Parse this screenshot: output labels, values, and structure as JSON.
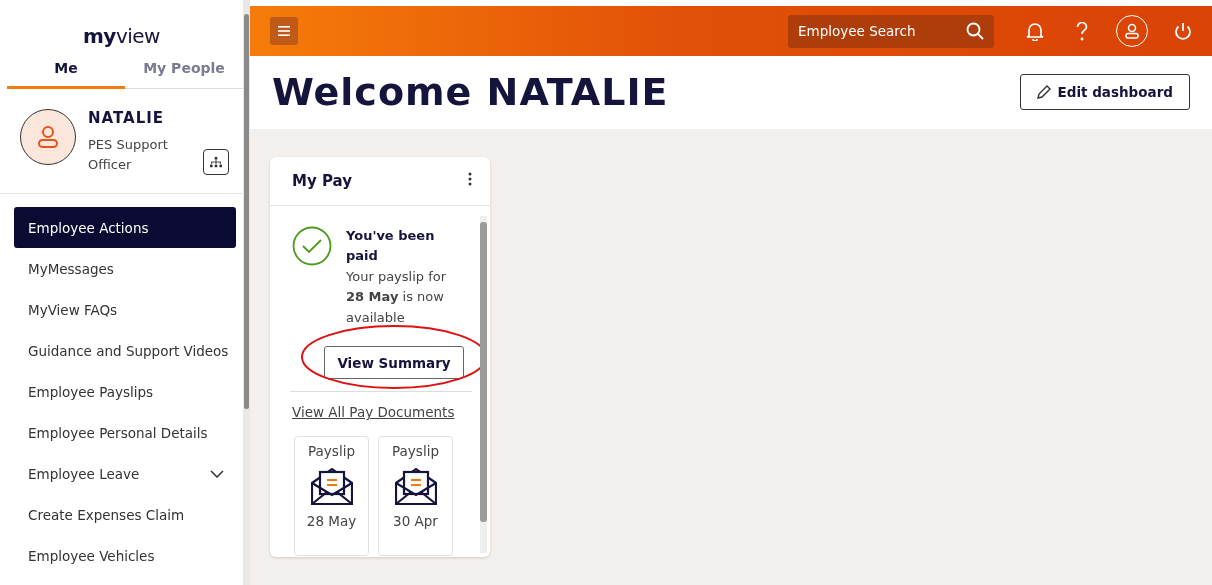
{
  "sidebar": {
    "logo": "**my**view",
    "tabs": [
      {
        "label": "Me",
        "selected": true
      },
      {
        "label": "My People",
        "selected": false
      }
    ],
    "profile": {
      "name": "NATALIE",
      "role": "PES Support Officer"
    },
    "items": [
      {
        "label": "Employee Actions",
        "selected": true,
        "expandable": false
      },
      {
        "label": "MyMessages",
        "selected": false,
        "expandable": false
      },
      {
        "label": "MyView FAQs",
        "selected": false,
        "expandable": false
      },
      {
        "label": "Guidance and Support Videos",
        "selected": false,
        "expandable": false
      },
      {
        "label": "Employee Payslips",
        "selected": false,
        "expandable": false
      },
      {
        "label": "Employee Personal Details",
        "selected": false,
        "expandable": false
      },
      {
        "label": "Employee Leave",
        "selected": false,
        "expandable": true
      },
      {
        "label": "Create Expenses Claim",
        "selected": false,
        "expandable": false
      },
      {
        "label": "Employee Vehicles",
        "selected": false,
        "expandable": false
      }
    ]
  },
  "header": {
    "search": {
      "placeholder": "Employee Search"
    }
  },
  "page": {
    "title": "Welcome NATALIE",
    "edit_button": "Edit dashboard"
  },
  "pay_card": {
    "title": "My Pay",
    "status_title": "You've been paid",
    "status_text": "Your payslip for **28 May** is now available",
    "summary_button": {
      "label": "View Summary",
      "circled": true
    },
    "link": "View All Pay Documents",
    "documents": [
      {
        "label": "Payslip",
        "date": "28 May"
      },
      {
        "label": "Payslip",
        "date": "30 Apr"
      }
    ]
  }
}
